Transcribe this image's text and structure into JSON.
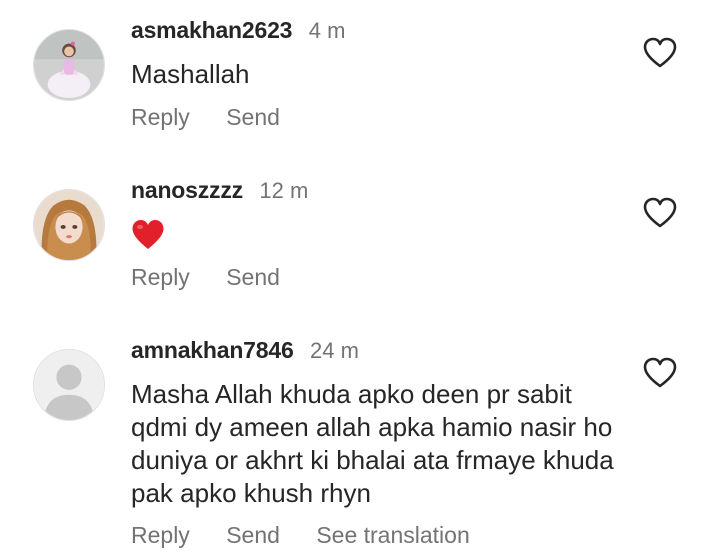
{
  "comments": [
    {
      "username": "asmakhan2623",
      "time": "4 m",
      "text": "Mashallah",
      "actions": [
        "Reply",
        "Send"
      ],
      "avatar_icon": "avatar-girl-white-dress"
    },
    {
      "username": "nanoszzzz",
      "time": "12 m",
      "text": "",
      "emoji_icon": "red-heart-emoji",
      "actions": [
        "Reply",
        "Send"
      ],
      "avatar_icon": "avatar-doll"
    },
    {
      "username": "amnakhan7846",
      "time": "24 m",
      "text": "Masha Allah khuda apko deen pr sabit qdmi dy ameen allah apka hamio nasir ho duniya or akhrt ki bhalai ata frmaye khuda pak apko khush rhyn",
      "actions": [
        "Reply",
        "Send",
        "See translation"
      ],
      "avatar_icon": "avatar-default-placeholder"
    }
  ],
  "colors": {
    "text": "#262626",
    "secondary": "#737373",
    "heart_emoji": "#e0202b",
    "like_outline": "#262626"
  }
}
